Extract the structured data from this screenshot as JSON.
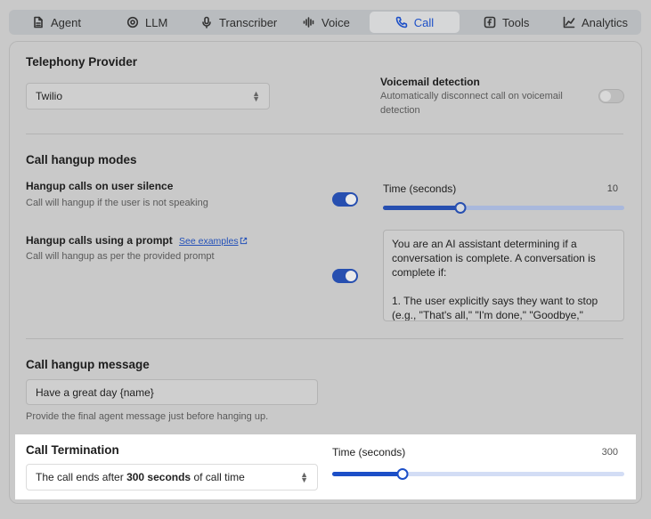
{
  "tabs": [
    {
      "label": "Agent",
      "icon": "document-icon"
    },
    {
      "label": "LLM",
      "icon": "gear-icon"
    },
    {
      "label": "Transcriber",
      "icon": "microphone-icon"
    },
    {
      "label": "Voice",
      "icon": "waveform-icon"
    },
    {
      "label": "Call",
      "icon": "phone-icon",
      "active": true
    },
    {
      "label": "Tools",
      "icon": "function-icon"
    },
    {
      "label": "Analytics",
      "icon": "chart-icon"
    }
  ],
  "telephony": {
    "title": "Telephony Provider",
    "provider": "Twilio"
  },
  "voicemail": {
    "title": "Voicemail detection",
    "description": "Automatically disconnect call on voicemail detection",
    "enabled": false
  },
  "hangup_modes": {
    "title": "Call hangup modes",
    "silence": {
      "label": "Hangup calls on user silence",
      "description": "Call will hangup if the user is not speaking",
      "enabled": true,
      "time_label": "Time (seconds)",
      "time_value": "10",
      "slider_fraction": 0.32
    },
    "prompt": {
      "label": "Hangup calls using a prompt",
      "link": "See examples",
      "description": "Call will hangup as per the provided prompt",
      "enabled": true,
      "prompt_text": "You are an AI assistant determining if a conversation is complete. A conversation is complete if:\n\n1. The user explicitly says they want to stop (e.g., \"That's all,\" \"I'm done,\" \"Goodbye,\" \"thank"
    }
  },
  "hangup_message": {
    "title": "Call hangup message",
    "value": "Have a great day {name}",
    "help": "Provide the final agent message just before hanging up."
  },
  "termination": {
    "title": "Call Termination",
    "select_prefix": "The call ends after ",
    "select_bold": "300 seconds",
    "select_suffix": " of call time",
    "time_label": "Time (seconds)",
    "time_value": "300",
    "slider_fraction": 0.24
  },
  "colors": {
    "accent": "#1c4fc7",
    "toggle_on": "#274fb0",
    "slider_track": "#a9b8dc",
    "slider_track_bright": "#d3ddf5",
    "highlight_bg": "#ffffff"
  }
}
